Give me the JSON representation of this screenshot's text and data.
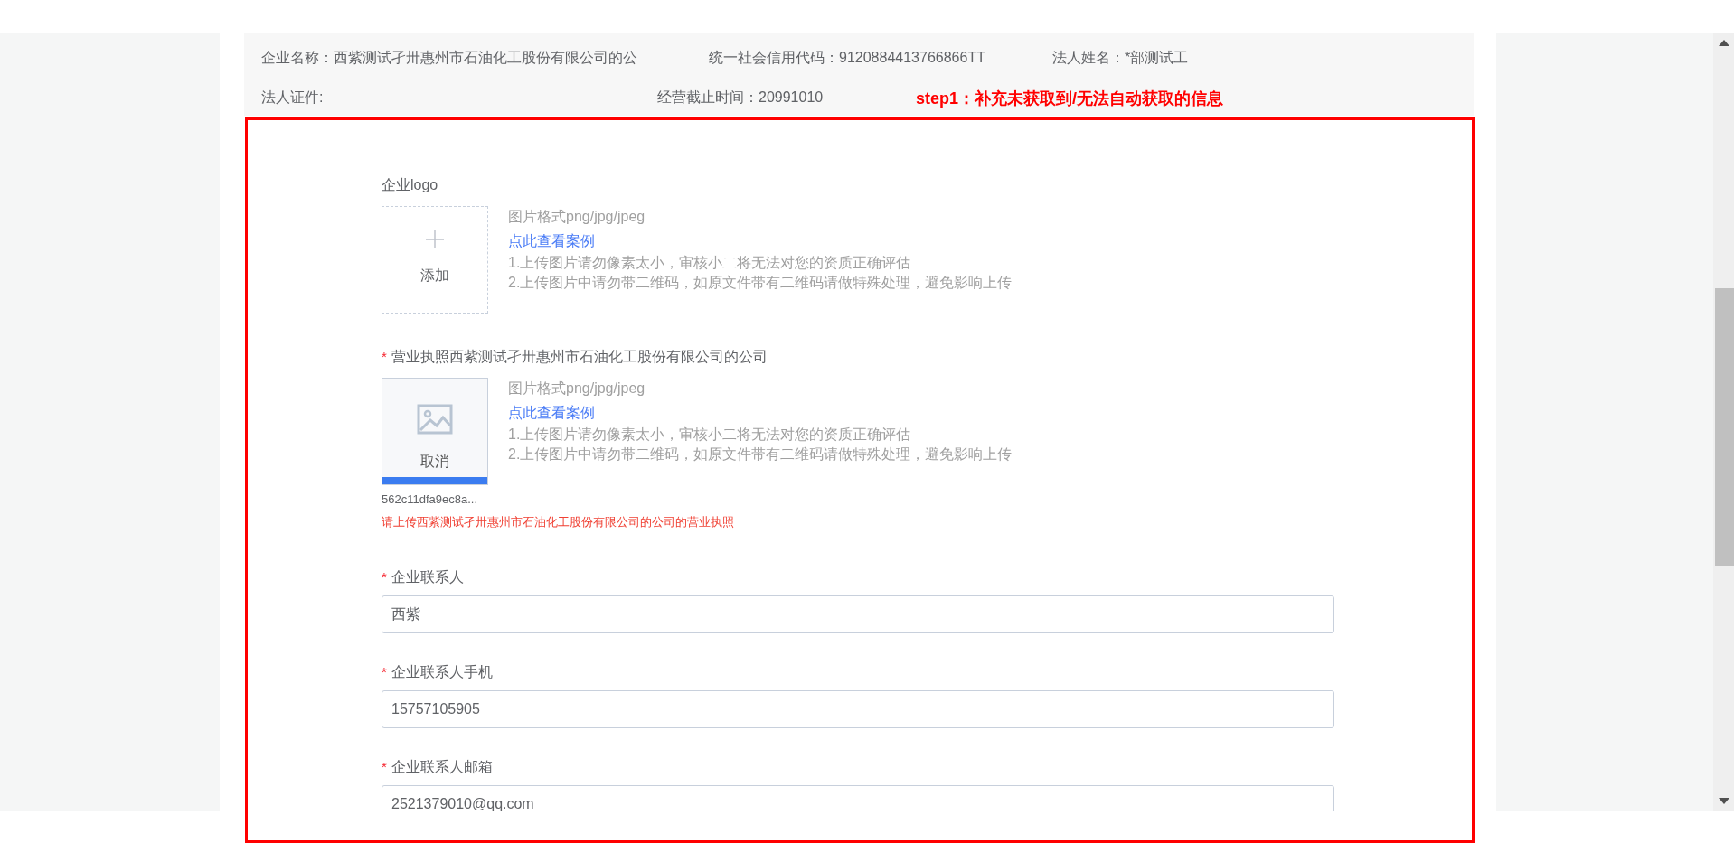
{
  "info_rows": [
    [
      {
        "label": "企业名称：",
        "value": "西紫测试孑卅惠州市石油化工股份有限公司的公"
      },
      {
        "label": "统一社会信用代码：",
        "value": "9120884413766866TT"
      },
      {
        "label": "法人姓名：",
        "value": "*部测试工"
      }
    ],
    [
      {
        "label": "法人证件:"
      },
      {
        "label": "经营截止时间：",
        "value": "20991010"
      }
    ]
  ],
  "annotation": "step1：补充未获取到/无法自动获取的信息",
  "form": [
    {
      "kind": "upload",
      "label": "企业logo",
      "uploaded": false,
      "button": "添加",
      "format": "图片格式png/jpg/jpeg",
      "example_link": "点此查看案例",
      "notes": [
        "1.上传图片请勿像素太小，审核小二将无法对您的资质正确评估",
        "2.上传图片中请勿带二维码，如原文件带有二维码请做特殊处理，避免影响上传"
      ]
    },
    {
      "kind": "upload",
      "label": "营业执照西紫测试孑卅惠州市石油化工股份有限公司的公司",
      "required_mark": "*",
      "uploaded": true,
      "button": "取消",
      "filename": "562c11dfa9ec8a...",
      "error": "请上传西紫测试孑卅惠州市石油化工股份有限公司的公司的营业执照",
      "format": "图片格式png/jpg/jpeg",
      "example_link": "点此查看案例",
      "notes": [
        "1.上传图片请勿像素太小，审核小二将无法对您的资质正确评估",
        "2.上传图片中请勿带二维码，如原文件带有二维码请做特殊处理，避免影响上传"
      ]
    },
    {
      "kind": "input",
      "label": "企业联系人",
      "required_mark": "*",
      "value": "西紫"
    },
    {
      "kind": "input",
      "label": "企业联系人手机",
      "required_mark": "*",
      "value": "15757105905"
    },
    {
      "kind": "input",
      "label": "企业联系人邮箱",
      "required_mark": "*",
      "value": "2521379010@qq.com"
    }
  ]
}
